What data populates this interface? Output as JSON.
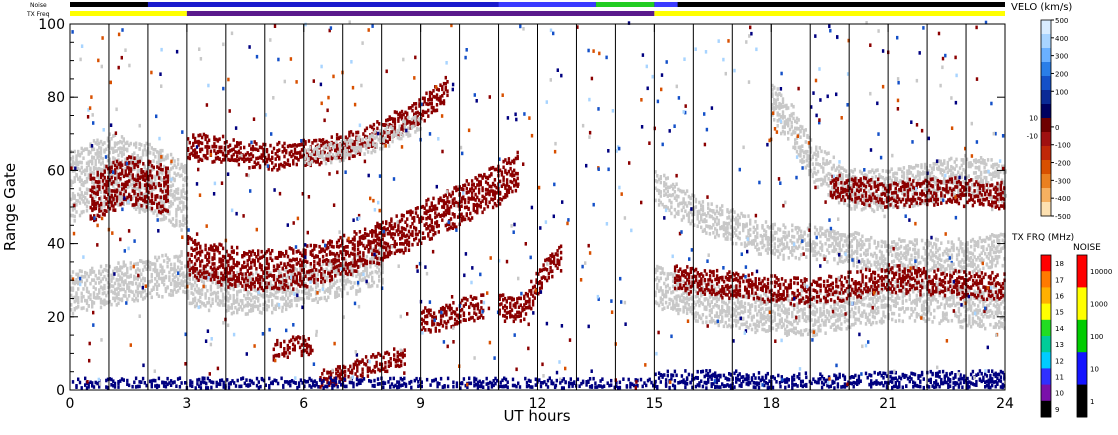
{
  "chart_data": {
    "type": "heatmap",
    "xlabel": "UT hours",
    "ylabel": "Range Gate",
    "xlim": [
      0,
      24
    ],
    "ylim": [
      0,
      100
    ],
    "xticks": [
      "0",
      "3",
      "6",
      "9",
      "12",
      "15",
      "18",
      "21",
      "24"
    ],
    "yticks": [
      "0",
      "20",
      "40",
      "60",
      "80",
      "100"
    ],
    "top_bars": {
      "noise_label": "Noise",
      "txfreq_label": "TX Freq",
      "noise_segments": [
        {
          "from": 0,
          "to": 2,
          "color": "#000000"
        },
        {
          "from": 2,
          "to": 11,
          "color": "#1a1acc"
        },
        {
          "from": 11,
          "to": 13.5,
          "color": "#3b3bff"
        },
        {
          "from": 13.5,
          "to": 15,
          "color": "#22cc22"
        },
        {
          "from": 15,
          "to": 15.6,
          "color": "#3b3bff"
        },
        {
          "from": 15.6,
          "to": 24,
          "color": "#000000"
        }
      ],
      "txfreq_segments": [
        {
          "from": 0,
          "to": 3,
          "color": "#ffff00"
        },
        {
          "from": 3,
          "to": 15,
          "color": "#5a1a8c"
        },
        {
          "from": 15,
          "to": 24,
          "color": "#ffff00"
        }
      ]
    },
    "vertical_lines_ut": [
      1,
      2,
      3,
      4,
      5,
      6,
      7,
      8,
      9,
      10,
      11,
      12,
      13,
      14,
      15,
      16,
      17,
      18,
      19,
      20,
      21,
      22,
      23
    ],
    "scatter_bands": [
      {
        "name": "",
        "color": "#c8c8c8",
        "points": [
          [
            0,
            55
          ],
          [
            1,
            60
          ],
          [
            2,
            57
          ],
          [
            3,
            52
          ]
        ],
        "halfwidth": 9
      },
      {
        "name": "",
        "color": "#8b0000",
        "points": [
          [
            0.5,
            52
          ],
          [
            1.5,
            57
          ],
          [
            2.5,
            54
          ]
        ],
        "halfwidth": 6
      },
      {
        "name": "",
        "color": "#8b0000",
        "points": [
          [
            3,
            66
          ],
          [
            4,
            65
          ],
          [
            5,
            63
          ],
          [
            6,
            64
          ],
          [
            7,
            66
          ],
          [
            8,
            70
          ],
          [
            9,
            76
          ],
          [
            9.7,
            82
          ]
        ],
        "halfwidth": 3
      },
      {
        "name": "",
        "color": "#c8c8c8",
        "points": [
          [
            6,
            63
          ],
          [
            7,
            65
          ],
          [
            8,
            68
          ],
          [
            9,
            73
          ]
        ],
        "halfwidth": 2
      },
      {
        "name": "",
        "color": "#c8c8c8",
        "points": [
          [
            0,
            26
          ],
          [
            1,
            28
          ],
          [
            2,
            30
          ],
          [
            3,
            32
          ]
        ],
        "halfwidth": 5
      },
      {
        "name": "",
        "color": "#c8c8c8",
        "points": [
          [
            3,
            28
          ],
          [
            4,
            26
          ],
          [
            5,
            26
          ],
          [
            6,
            28
          ],
          [
            7,
            30
          ],
          [
            8,
            34
          ]
        ],
        "halfwidth": 5
      },
      {
        "name": "",
        "color": "#8b0000",
        "points": [
          [
            3,
            36
          ],
          [
            4,
            33
          ],
          [
            5,
            32
          ],
          [
            6,
            33
          ],
          [
            7,
            36
          ],
          [
            8,
            40
          ],
          [
            9,
            45
          ],
          [
            10,
            50
          ],
          [
            11,
            56
          ],
          [
            11.5,
            60
          ]
        ],
        "halfwidth": 5
      },
      {
        "name": "",
        "color": "#8b0000",
        "points": [
          [
            9,
            18
          ],
          [
            9.8,
            20
          ],
          [
            10.6,
            23
          ]
        ],
        "halfwidth": 3
      },
      {
        "name": "",
        "color": "#8b0000",
        "points": [
          [
            11,
            22
          ],
          [
            11.6,
            22
          ],
          [
            12.2,
            32
          ],
          [
            12.6,
            36
          ]
        ],
        "halfwidth": 3
      },
      {
        "name": "",
        "color": "#8b0000",
        "points": [
          [
            6.4,
            2
          ],
          [
            7.2,
            5
          ],
          [
            8.0,
            7
          ],
          [
            8.6,
            9
          ]
        ],
        "halfwidth": 2
      },
      {
        "name": "",
        "color": "#8b0000",
        "points": [
          [
            5.2,
            10
          ],
          [
            5.8,
            12
          ],
          [
            6.2,
            11
          ]
        ],
        "halfwidth": 2
      },
      {
        "name": "",
        "color": "#c8c8c8",
        "points": [
          [
            15,
            55
          ],
          [
            16,
            48
          ],
          [
            17,
            44
          ],
          [
            18,
            40
          ],
          [
            19,
            40
          ],
          [
            20,
            38
          ],
          [
            21,
            36
          ],
          [
            22,
            36
          ],
          [
            23,
            36
          ],
          [
            24,
            38
          ]
        ],
        "halfwidth": 4
      },
      {
        "name": "",
        "color": "#c8c8c8",
        "points": [
          [
            15,
            28
          ],
          [
            16,
            24
          ],
          [
            17,
            22
          ],
          [
            18,
            20
          ],
          [
            19,
            20
          ],
          [
            20,
            22
          ],
          [
            21,
            24
          ],
          [
            22,
            24
          ],
          [
            23,
            22
          ],
          [
            24,
            22
          ]
        ],
        "halfwidth": 5
      },
      {
        "name": "",
        "color": "#c8c8c8",
        "points": [
          [
            18,
            78
          ],
          [
            18.5,
            72
          ],
          [
            19,
            62
          ],
          [
            20,
            54
          ],
          [
            21,
            54
          ],
          [
            22,
            56
          ],
          [
            23,
            58
          ],
          [
            24,
            56
          ]
        ],
        "halfwidth": 5
      },
      {
        "name": "",
        "color": "#8b0000",
        "points": [
          [
            19.5,
            55
          ],
          [
            21,
            53
          ],
          [
            22.5,
            54
          ],
          [
            24,
            52
          ]
        ],
        "halfwidth": 3
      },
      {
        "name": "",
        "color": "#8b0000",
        "points": [
          [
            15.5,
            30
          ],
          [
            17,
            28
          ],
          [
            19,
            26
          ],
          [
            21,
            30
          ],
          [
            23,
            28
          ],
          [
            24,
            28
          ]
        ],
        "halfwidth": 3
      },
      {
        "name": "",
        "color": "#000080",
        "points": [
          [
            15,
            2
          ],
          [
            17,
            2
          ],
          [
            19,
            1
          ],
          [
            21,
            2
          ],
          [
            23,
            2
          ],
          [
            24,
            2
          ]
        ],
        "halfwidth": 2
      },
      {
        "name": "",
        "color": "#000080",
        "points": [
          [
            0,
            1
          ],
          [
            5,
            1
          ],
          [
            10,
            1
          ],
          [
            15,
            1
          ]
        ],
        "halfwidth": 1
      }
    ],
    "colorbar_velocity": {
      "title": "VELO (km/s)",
      "ticks": [
        "500",
        "400",
        "300",
        "200",
        "100",
        "10",
        "0",
        "-10",
        "-100",
        "-200",
        "-300",
        "-400",
        "-500"
      ],
      "colors": [
        "#d8ecff",
        "#a8d4ff",
        "#6ab0ff",
        "#2a7ee8",
        "#1450c8",
        "#0a2a96",
        "#000060",
        "#6e0000",
        "#a01010",
        "#c02808",
        "#d85000",
        "#ea8020",
        "#f6b060",
        "#fde0b0"
      ]
    },
    "colorbar_txfreq": {
      "title": "TX FRQ (MHz)",
      "ticks": [
        "18",
        "17",
        "16",
        "15",
        "14",
        "13",
        "12",
        "11",
        "10",
        "9"
      ],
      "colors": [
        "#ff0000",
        "#ff7a00",
        "#ffb000",
        "#ffff00",
        "#22dd22",
        "#00cc99",
        "#00ccff",
        "#3030ff",
        "#7a10aa",
        "#000000"
      ]
    },
    "colorbar_noise": {
      "title": "NOISE",
      "ticks": [
        "10000",
        "1000",
        "100",
        "10",
        "1"
      ],
      "colors": [
        "#ff0000",
        "#ffff00",
        "#00cc00",
        "#1414ff",
        "#000000"
      ]
    }
  }
}
